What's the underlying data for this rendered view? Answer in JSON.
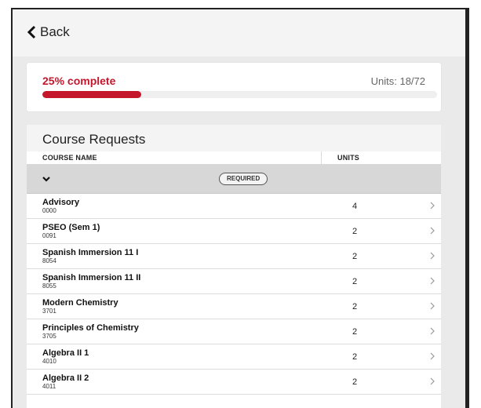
{
  "nav": {
    "back_label": "Back"
  },
  "progress": {
    "percent_label": "25% complete",
    "units_label": "Units: 18/72",
    "fraction": 0.25,
    "accent_color": "#c4172c"
  },
  "course_requests": {
    "title": "Course Requests",
    "columns": {
      "name": "COURSE NAME",
      "units": "UNITS"
    },
    "group": {
      "badge": "REQUIRED",
      "icon": "chevron-down-icon"
    },
    "rows": [
      {
        "name": "Advisory",
        "code": "0000",
        "units": "4"
      },
      {
        "name": "PSEO (Sem 1)",
        "code": "0091",
        "units": "2"
      },
      {
        "name": "Spanish Immersion 11 I",
        "code": "8054",
        "units": "2"
      },
      {
        "name": "Spanish Immersion 11 II",
        "code": "8055",
        "units": "2"
      },
      {
        "name": "Modern Chemistry",
        "code": "3701",
        "units": "2"
      },
      {
        "name": "Principles of Chemistry",
        "code": "3705",
        "units": "2"
      },
      {
        "name": "Algebra II 1",
        "code": "4010",
        "units": "2"
      },
      {
        "name": "Algebra II 2",
        "code": "4011",
        "units": "2"
      }
    ]
  }
}
